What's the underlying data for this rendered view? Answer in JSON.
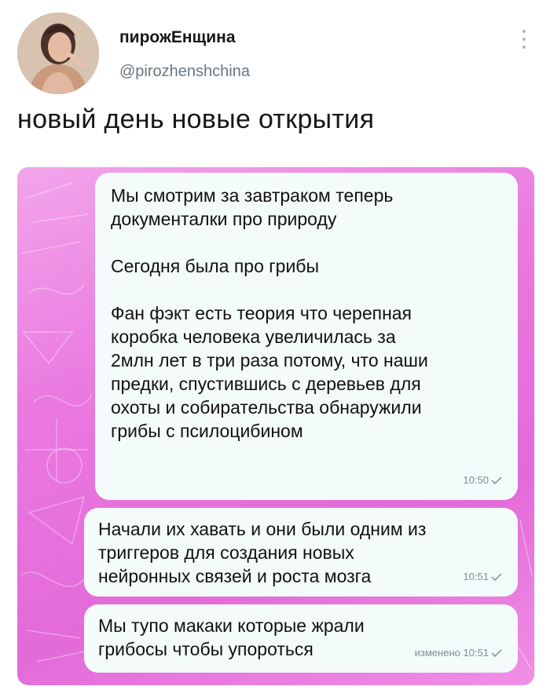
{
  "tweet": {
    "display_name": "пирожЕнщина",
    "handle": "@pirozhenshchina",
    "text": "новый день новые открытия"
  },
  "chat": {
    "messages": [
      {
        "lines": [
          "Мы смотрим за завтраком теперь",
          "документалки про природу",
          "",
          "Сегодня была про грибы",
          "",
          "Фан фэкт есть теория что черепная",
          "коробка человека увеличилась за",
          "2млн лет в три раза потому, что наши",
          "предки, спустившись с деревьев для",
          "охоты и собирательства обнаружили",
          "грибы с псилоцибином"
        ],
        "time": "10:50",
        "status": "sent"
      },
      {
        "lines": [
          "Начали их хавать и они были одним из",
          "триггеров для создания новых",
          "нейронных связей и роста мозга"
        ],
        "time": "10:51",
        "status": "sent"
      },
      {
        "lines": [
          "Мы тупо макаки которые жрали",
          "грибосы чтобы упороться"
        ],
        "time": "изменено 10:51",
        "status": "sent"
      }
    ],
    "background_color": "#e878de",
    "bubble_color": "#f4fbfb"
  },
  "icons": {
    "more": "more-vertical-icon",
    "check": "check-icon"
  }
}
